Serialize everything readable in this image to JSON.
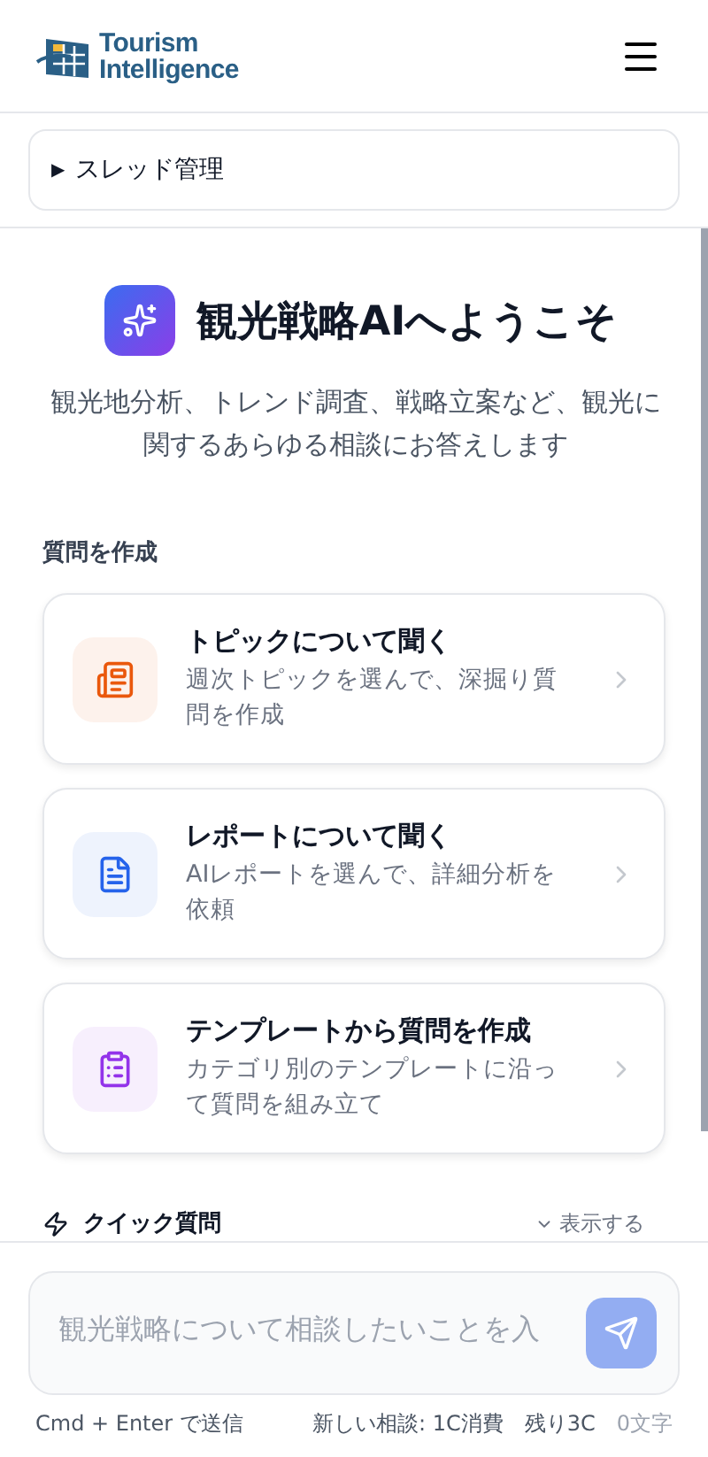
{
  "header": {
    "logo_line1": "Tourism",
    "logo_line2": "Intelligence"
  },
  "thread_panel": {
    "marker": "▶",
    "label": "スレッド管理"
  },
  "welcome": {
    "title": "観光戦略AIへようこそ",
    "subtitle": "観光地分析、トレンド調査、戦略立案など、観光に関するあらゆる相談にお答えします"
  },
  "section_label": "質問を作成",
  "options": [
    {
      "kind": "topic",
      "color": "#ea580c",
      "title": "トピックについて聞く",
      "description": "週次トピックを選んで、深掘り質問を作成"
    },
    {
      "kind": "report",
      "color": "#2563eb",
      "title": "レポートについて聞く",
      "description": "AIレポートを選んで、詳細分析を依頼"
    },
    {
      "kind": "template",
      "color": "#9333ea",
      "title": "テンプレートから質問を作成",
      "description": "カテゴリ別のテンプレートに沿って質問を組み立て"
    }
  ],
  "quick": {
    "label": "クイック質問",
    "toggle": "表示する"
  },
  "composer": {
    "placeholder": "観光戦略について相談したいことを入",
    "hint": "Cmd + Enter で送信",
    "cost": "新しい相談: 1C消費",
    "remaining": "残り3C",
    "count": "0文字"
  }
}
